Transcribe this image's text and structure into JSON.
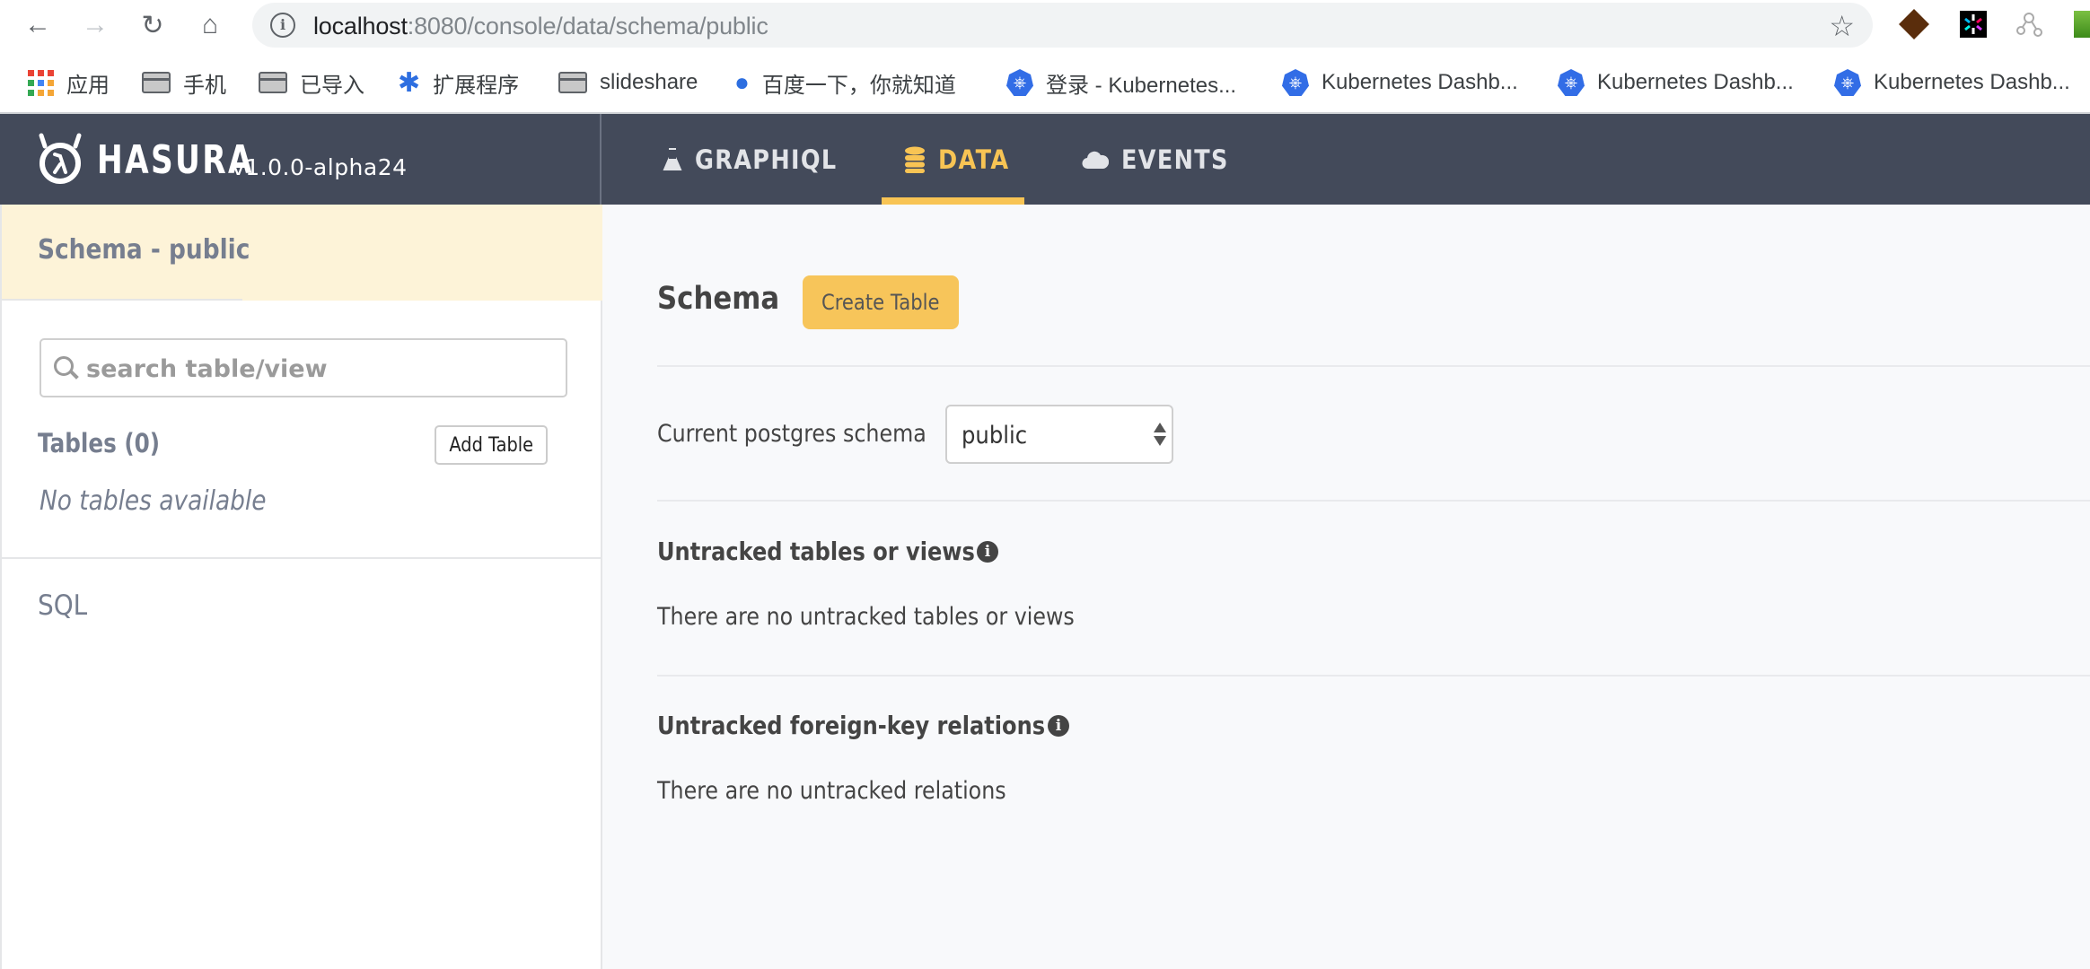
{
  "browser": {
    "url_host": "localhost",
    "url_path": ":8080/console/data/schema/public",
    "bookmarks": [
      {
        "icon": "apps-grid-icon",
        "label": "应用"
      },
      {
        "icon": "folder-icon",
        "label": "手机"
      },
      {
        "icon": "folder-icon",
        "label": "已导入"
      },
      {
        "icon": "puzzle-extension-icon",
        "label": "扩展程序"
      },
      {
        "icon": "folder-icon",
        "label": "slideshare"
      },
      {
        "icon": "baidu-paw-icon",
        "label": "百度一下，你就知道"
      },
      {
        "icon": "kubernetes-icon",
        "label": "登录 - Kubernetes..."
      },
      {
        "icon": "kubernetes-icon",
        "label": "Kubernetes Dashb..."
      },
      {
        "icon": "kubernetes-icon",
        "label": "Kubernetes Dashb..."
      },
      {
        "icon": "kubernetes-icon",
        "label": "Kubernetes Dashb..."
      }
    ]
  },
  "header": {
    "brand": "HASURA",
    "version": "v1.0.0-alpha24",
    "tabs": [
      {
        "label": "GRAPHIQL",
        "icon": "flask-icon",
        "active": false
      },
      {
        "label": "DATA",
        "icon": "database-icon",
        "active": true
      },
      {
        "label": "EVENTS",
        "icon": "cloud-icon",
        "active": false
      }
    ],
    "accent_color": "#f8c454"
  },
  "sidebar": {
    "title": "Schema - public",
    "search_placeholder": "search table/view",
    "search_value": "",
    "tables_label": "Tables (0)",
    "add_table_label": "Add Table",
    "empty_text": "No tables available",
    "sql_label": "SQL"
  },
  "main": {
    "title": "Schema",
    "create_table_label": "Create Table",
    "schema_label": "Current postgres schema",
    "schema_value": "public",
    "untracked_tables": {
      "title": "Untracked tables or views",
      "text": "There are no untracked tables or views"
    },
    "untracked_relations": {
      "title": "Untracked foreign-key relations",
      "text": "There are no untracked relations"
    }
  }
}
